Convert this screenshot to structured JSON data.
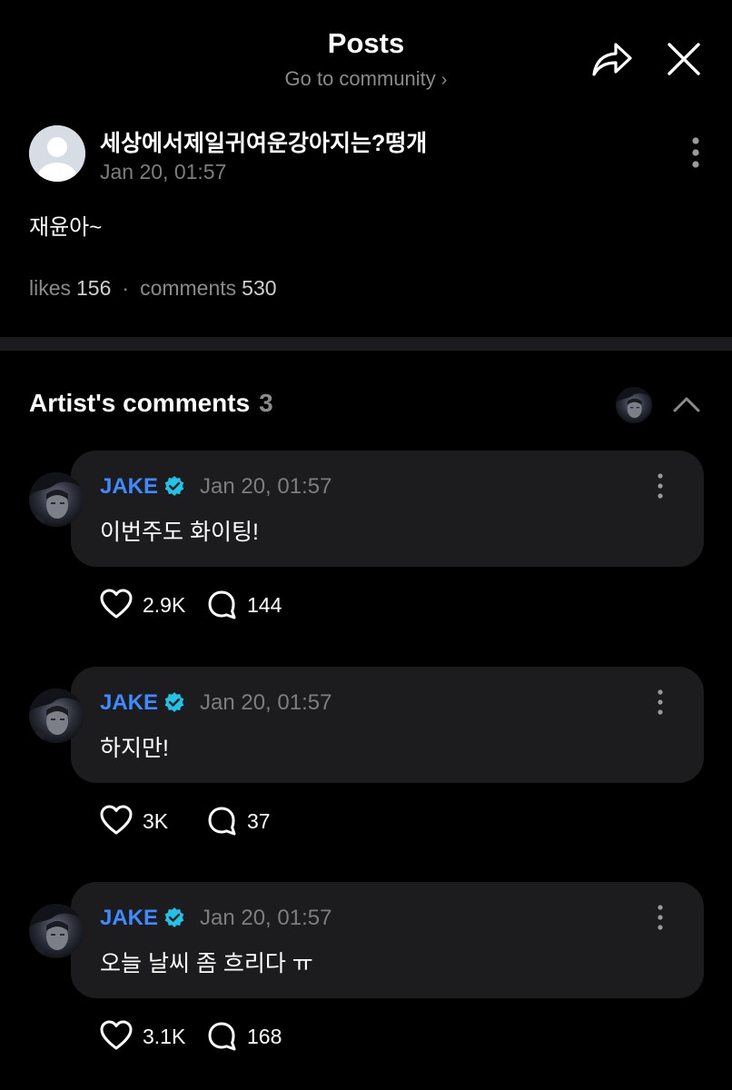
{
  "header": {
    "title": "Posts",
    "subtitle": "Go to community",
    "subtitle_chevron": "›",
    "icons": [
      "share-icon",
      "close-icon"
    ]
  },
  "post": {
    "author": "세상에서제일귀여운강아지는?떵개",
    "time": "Jan 20, 01:57",
    "body": "재윤아~",
    "likes_label": "likes",
    "likes": "156",
    "separator": "·",
    "comments_label": "comments",
    "comments": "530",
    "icons": [
      "avatar-placeholder-icon",
      "more-vertical-icon"
    ]
  },
  "artist_comments": {
    "title": "Artist's comments",
    "count": "3",
    "icons": [
      "artist-avatar",
      "chevron-up-icon"
    ],
    "items": [
      {
        "author": "JAKE",
        "time": "Jan 20, 01:57",
        "text": "이번주도 화이팅!",
        "likes": "2.9K",
        "replies": "144"
      },
      {
        "author": "JAKE",
        "time": "Jan 20, 01:57",
        "text": "하지만!",
        "likes": "3K",
        "replies": "37"
      },
      {
        "author": "JAKE",
        "time": "Jan 20, 01:57",
        "text": "오늘 날씨 좀 흐리다 ㅠ",
        "likes": "3.1K",
        "replies": "168"
      }
    ]
  },
  "colors": {
    "background": "#000000",
    "bubble": "#1c1c1e",
    "author_blue": "#3d8bff",
    "verified_cyan": "#20c4e8",
    "muted_text": "#8a8a8a"
  }
}
